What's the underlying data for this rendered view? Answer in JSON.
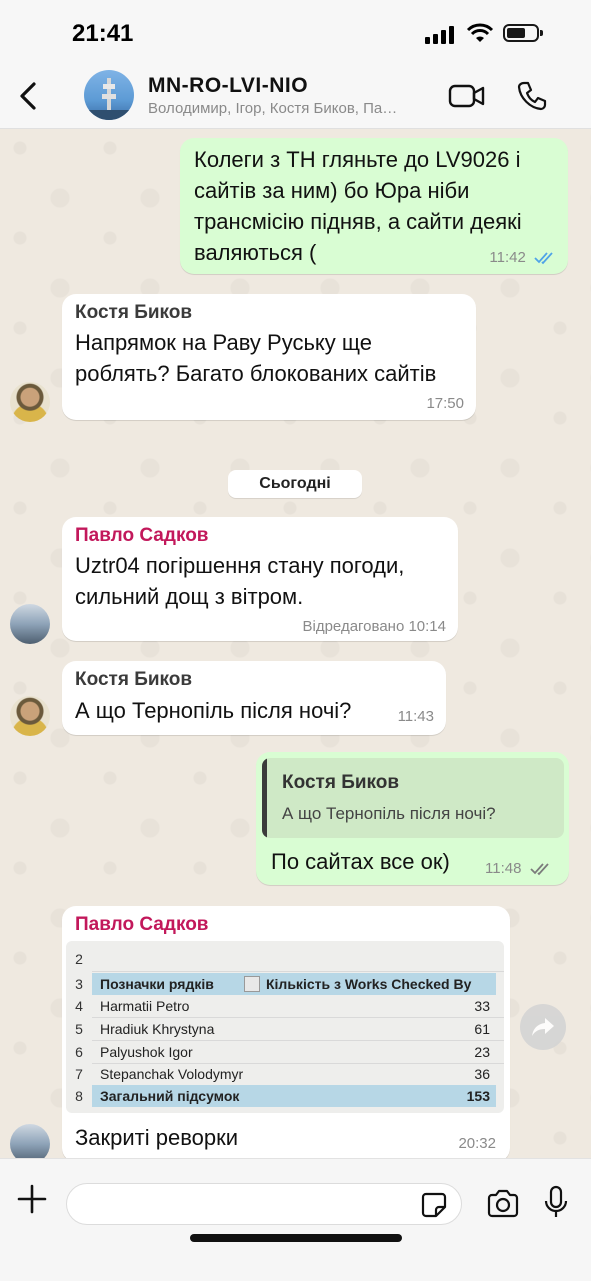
{
  "status_bar": {
    "time": "21:41"
  },
  "header": {
    "title": "MN-RO-LVI-NIO",
    "subtitle": "Володимир, Ігор, Костя Биков, Па…"
  },
  "messages": [
    {
      "direction": "outgoing",
      "text": "Колеги з ТН гляньте до LV9026 і сайтів за ним) бо Юра ніби трансмісію підняв, а сайти деякі валяються (",
      "lines": [
        "Колеги з ТН гляньте до LV9026 і",
        "сайтів за ним) бо Юра ніби",
        "трансмісію підняв, а сайти деякі",
        "валяються ("
      ],
      "time": "11:42",
      "status": "read"
    },
    {
      "direction": "incoming",
      "sender": "Костя Биков",
      "lines": [
        "Напрямок на Раву Руську ще",
        "роблять? Багато блокованих сайтів"
      ],
      "time": "17:50"
    }
  ],
  "date_separator": "Сьогодні",
  "messages_today": [
    {
      "direction": "incoming",
      "sender": "Павло Садков",
      "lines": [
        "Uztr04 погіршення стану погоди,",
        "сильний дощ з вітром."
      ],
      "time": "Відредаговано 10:14"
    },
    {
      "direction": "incoming",
      "sender": "Костя Биков",
      "text": "А що Тернопіль після ночі?",
      "time": "11:43"
    },
    {
      "direction": "outgoing",
      "quote": {
        "sender": "Костя Биков",
        "text": "А що Тернопіль після ночі?"
      },
      "text": "По сайтах все ок)",
      "time": "11:48",
      "status": "delivered"
    },
    {
      "direction": "incoming",
      "sender": "Павло Садков",
      "caption": "Закриті реворки",
      "time": "20:32",
      "image_table": {
        "row_numbers": [
          "2",
          "3",
          "4",
          "5",
          "6",
          "7",
          "8"
        ],
        "header": [
          "Позначки рядків",
          "Кількість з Works Checked By"
        ],
        "rows": [
          {
            "name": "Harmatii Petro",
            "value": "33"
          },
          {
            "name": "Hradiuk Khrystyna",
            "value": "61"
          },
          {
            "name": "Palyushok Igor",
            "value": "23"
          },
          {
            "name": "Stepanchak Volodymyr",
            "value": "36"
          }
        ],
        "total": {
          "name": "Загальний підсумок",
          "value": "153"
        }
      }
    }
  ],
  "input": {
    "placeholder": ""
  },
  "colors": {
    "sender_pavlo": "#c2185b",
    "sender_kostya": "#3b3b3b",
    "read_ticks": "#4fa3e8",
    "outgoing_bubble": "#d9fdd3"
  }
}
